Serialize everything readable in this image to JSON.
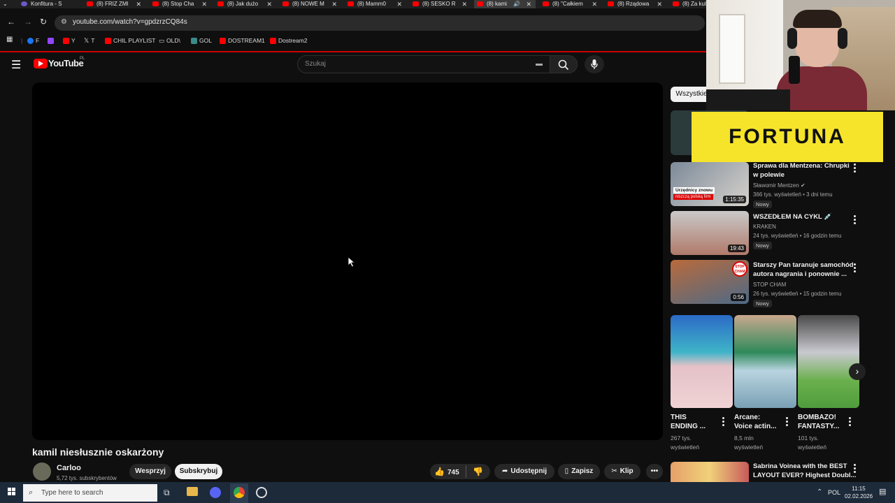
{
  "browser": {
    "tabs": [
      {
        "label": "Konfitura - S",
        "active": false
      },
      {
        "label": "(8) FRIZ ZMI",
        "active": false
      },
      {
        "label": "(8) Stop Cha",
        "active": false
      },
      {
        "label": "(8) Jak dużo",
        "active": false
      },
      {
        "label": "(8) NOWE M",
        "active": false
      },
      {
        "label": "(8) Mamm0",
        "active": false
      },
      {
        "label": "(8) SESKO R",
        "active": false
      },
      {
        "label": "(8) kami",
        "active": true
      },
      {
        "label": "(8) \"Całkiem",
        "active": false
      },
      {
        "label": "(8) Rządowa",
        "active": false
      },
      {
        "label": "(8) Za kuli",
        "active": false
      }
    ],
    "url": "youtube.com/watch?v=gpdzrzCQ84s",
    "bookmarks": [
      "F",
      "Y",
      "T",
      "CHIL PLAYLIST",
      "OLD\\",
      "GOL",
      "DOSTREAM1",
      "Dostream2"
    ]
  },
  "youtube": {
    "logo_text": "YouTube",
    "region": "PL",
    "search_placeholder": "Szukaj",
    "video_title": "kamil niesłusznie oskarżony",
    "channel_name": "Carloo",
    "channel_subs": "5,72 tys. subskrybentów",
    "support_label": "Wesprzyj",
    "subscribe_label": "Subskrybuj",
    "like_count": "745",
    "share_label": "Udostępnij",
    "save_label": "Zapisz",
    "clip_label": "Klip",
    "chip_all": "Wszystkie"
  },
  "sidebar": {
    "ad_text": "FORTUNA",
    "videos": [
      {
        "title_line1": "Sprawa dla Mentzena: Chrupki",
        "title_line2": "w polewie",
        "channel": "Sławomir Mentzen",
        "meta": "366 tys. wyświetleń • 3 dni temu",
        "badge": "Nowy",
        "duration": "1:15:35",
        "thumb_caption": "Urzędnicy znowu",
        "thumb_caption2": "niszczą polską firm"
      },
      {
        "title_line1": "WSZEDŁEM NA CYKL 💉",
        "title_line2": "",
        "channel": "KRAKEN",
        "meta": "24 tys. wyświetleń • 16 godzin temu",
        "badge": "Nowy",
        "duration": "19:43"
      },
      {
        "title_line1": "Starszy Pan taranuje samochód",
        "title_line2": "autora nagrania i ponownie ...",
        "channel": "STOP CHAM",
        "meta": "26 tys. wyświetleń • 15 godzin temu",
        "badge": "Nowy",
        "duration": "0:56",
        "thumb_badge": "STOP CHAM"
      }
    ],
    "shorts": [
      {
        "title_line1": "THIS",
        "title_line2": "ENDING ...",
        "views_line1": "267 tys.",
        "views_line2": "wyświetleń"
      },
      {
        "title_line1": "Arcane:",
        "title_line2": "Voice actin...",
        "views_line1": "8,5 mln",
        "views_line2": "wyświetleń"
      },
      {
        "title_line1": "BOMBAZO!",
        "title_line2": "FANTASTY...",
        "views_line1": "101 tys.",
        "views_line2": "wyświetleń"
      }
    ],
    "bottom_video": {
      "title_line1": "Sabrina Voinea with the BEST",
      "title_line2": "LAYOUT EVER? Highest Doubl..."
    }
  },
  "taskbar": {
    "search_placeholder": "Type here to search",
    "language": "POL",
    "time": "11:15",
    "date": "02.02.2026"
  },
  "colors": {
    "yt_red": "#ff0000",
    "background": "#0f0f0f",
    "taskbar": "#1c2a3a",
    "fortuna_yellow": "#f5e42a"
  }
}
